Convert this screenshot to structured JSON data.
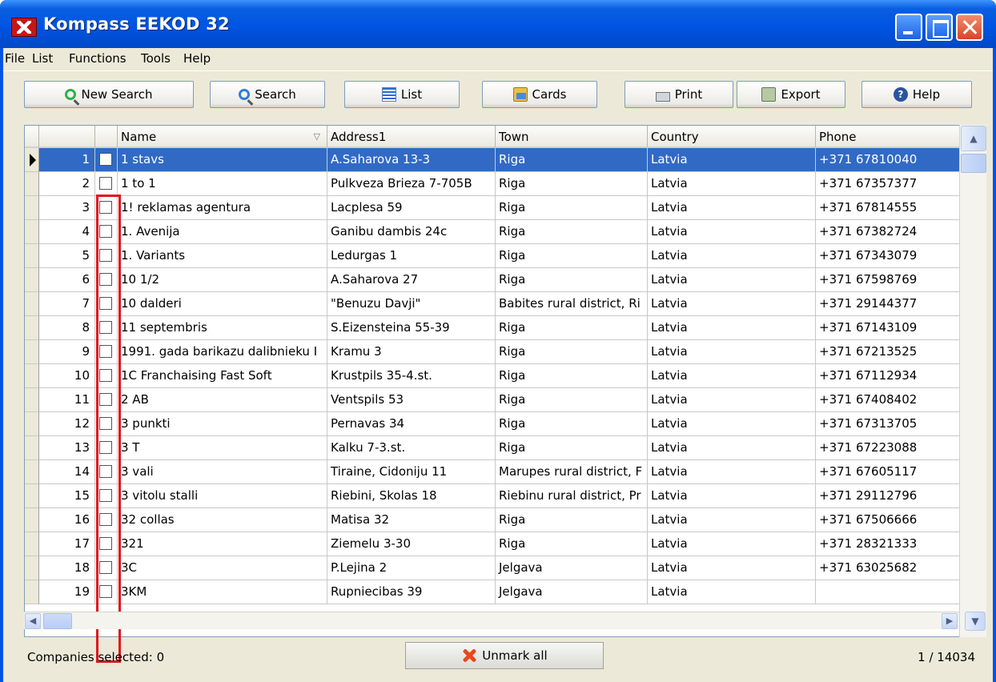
{
  "window": {
    "title": "Kompass EEKOD 32"
  },
  "menu": [
    "File",
    "List",
    "Functions",
    "Tools",
    "Help"
  ],
  "toolbar": {
    "new_search": "New Search",
    "search": "Search",
    "list": "List",
    "cards": "Cards",
    "print": "Print",
    "export": "Export",
    "help": "Help"
  },
  "columns": [
    "Name",
    "Address1",
    "Town",
    "Country",
    "Phone"
  ],
  "rows": [
    {
      "n": "1",
      "name": "1 stavs",
      "addr": "A.Saharova 13-3",
      "town": "Riga",
      "country": "Latvia",
      "phone": "+371 67810040"
    },
    {
      "n": "2",
      "name": "1 to 1",
      "addr": "Pulkveza Brieza 7-705B",
      "town": "Riga",
      "country": "Latvia",
      "phone": "+371 67357377"
    },
    {
      "n": "3",
      "name": "1! reklamas agentura",
      "addr": "Lacplesa 59",
      "town": "Riga",
      "country": "Latvia",
      "phone": "+371 67814555"
    },
    {
      "n": "4",
      "name": "1. Avenija",
      "addr": "Ganibu dambis 24c",
      "town": "Riga",
      "country": "Latvia",
      "phone": "+371 67382724"
    },
    {
      "n": "5",
      "name": "1. Variants",
      "addr": "Ledurgas 1",
      "town": "Riga",
      "country": "Latvia",
      "phone": "+371 67343079"
    },
    {
      "n": "6",
      "name": "10 1/2",
      "addr": "A.Saharova 27",
      "town": "Riga",
      "country": "Latvia",
      "phone": "+371 67598769"
    },
    {
      "n": "7",
      "name": "10 dalderi",
      "addr": "\"Benuzu Davji\"",
      "town": "Babites rural district, Ri",
      "country": "Latvia",
      "phone": "+371 29144377"
    },
    {
      "n": "8",
      "name": "11 septembris",
      "addr": "S.Eizensteina 55-39",
      "town": "Riga",
      "country": "Latvia",
      "phone": "+371 67143109"
    },
    {
      "n": "9",
      "name": "1991. gada barikazu dalibnieku I",
      "addr": "Kramu 3",
      "town": "Riga",
      "country": "Latvia",
      "phone": "+371 67213525"
    },
    {
      "n": "10",
      "name": "1C Franchaising Fast Soft",
      "addr": "Krustpils 35-4.st.",
      "town": "Riga",
      "country": "Latvia",
      "phone": "+371 67112934"
    },
    {
      "n": "11",
      "name": "2 AB",
      "addr": "Ventspils 53",
      "town": "Riga",
      "country": "Latvia",
      "phone": "+371 67408402"
    },
    {
      "n": "12",
      "name": "3 punkti",
      "addr": "Pernavas 34",
      "town": "Riga",
      "country": "Latvia",
      "phone": "+371 67313705"
    },
    {
      "n": "13",
      "name": "3 T",
      "addr": "Kalku 7-3.st.",
      "town": "Riga",
      "country": "Latvia",
      "phone": "+371 67223088"
    },
    {
      "n": "14",
      "name": "3 vali",
      "addr": "Tiraine, Cidoniju 11",
      "town": "Marupes rural district, F",
      "country": "Latvia",
      "phone": "+371 67605117"
    },
    {
      "n": "15",
      "name": "3 vitolu stalli",
      "addr": "Riebini, Skolas 18",
      "town": "Riebinu rural district, Pr",
      "country": "Latvia",
      "phone": "+371 29112796"
    },
    {
      "n": "16",
      "name": "32 collas",
      "addr": "Matisa 32",
      "town": "Riga",
      "country": "Latvia",
      "phone": "+371 67506666"
    },
    {
      "n": "17",
      "name": "321",
      "addr": "Ziemelu 3-30",
      "town": "Riga",
      "country": "Latvia",
      "phone": "+371 28321333"
    },
    {
      "n": "18",
      "name": "3C",
      "addr": "P.Lejina 2",
      "town": "Jelgava",
      "country": "Latvia",
      "phone": "+371 63025682"
    },
    {
      "n": "19",
      "name": "3KM",
      "addr": "Rupniecibas 39",
      "town": "Jelgava",
      "country": "Latvia",
      "phone": ""
    }
  ],
  "selected_row": "1",
  "status": {
    "selected": "Companies selected: 0",
    "unmark": "Unmark all",
    "position": "1 / 14034"
  },
  "colors": {
    "selection": "#316ac5",
    "highlight": "#e0151b"
  }
}
